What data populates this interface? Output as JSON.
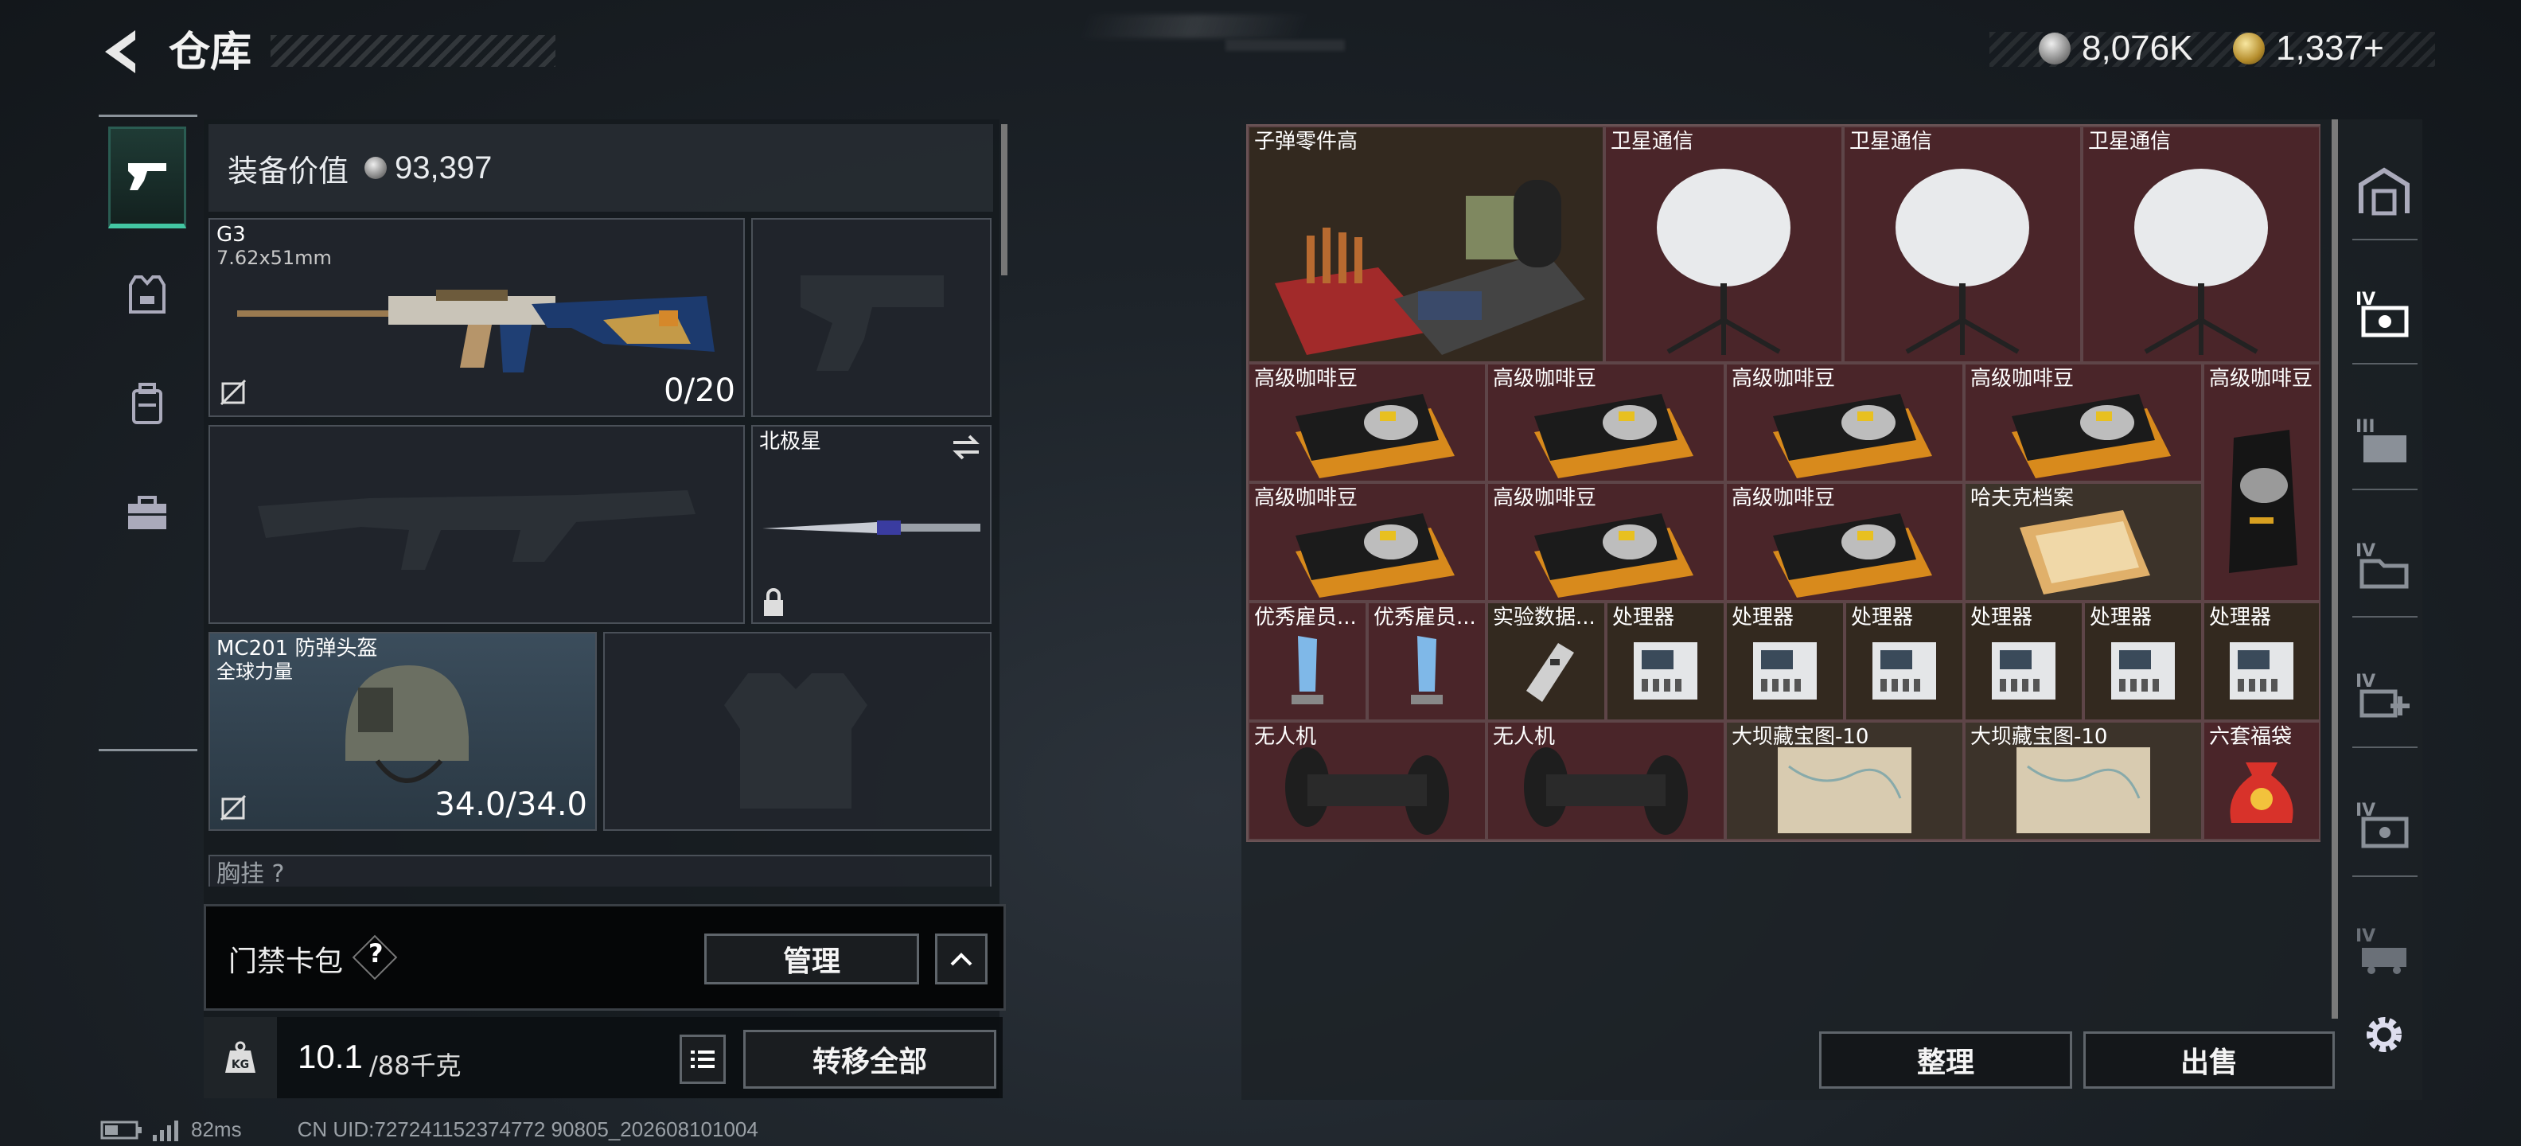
{
  "header": {
    "title": "仓库",
    "currency_silver": "8,076K",
    "currency_gold": "1,337+"
  },
  "rail": {
    "items": [
      "weapon-pistol-icon",
      "armor-vest-icon",
      "backpack-icon",
      "briefcase-icon"
    ]
  },
  "loadout": {
    "value_label": "装备价值",
    "value": "93,397",
    "primary": {
      "name": "G3",
      "caliber": "7.62x51mm",
      "ammo": "0/20"
    },
    "melee": {
      "name": "北极星"
    },
    "helmet": {
      "name": "MC201 防弹头盔",
      "sub": "全球力量",
      "durability": "34.0/34.0"
    },
    "chest_partial": "胸挂 ?"
  },
  "keycard": {
    "label": "门禁卡包",
    "help": "?",
    "manage_label": "管理"
  },
  "capacity": {
    "current": "10.1",
    "max": "/88千克",
    "transfer_label": "转移全部"
  },
  "stash": {
    "cells": [
      {
        "name": "子弹零件高"
      },
      {
        "name": "卫星通信"
      },
      {
        "name": "卫星通信"
      },
      {
        "name": "卫星通信"
      },
      {
        "name": "高级咖啡豆"
      },
      {
        "name": "高级咖啡豆"
      },
      {
        "name": "高级咖啡豆"
      },
      {
        "name": "高级咖啡豆"
      },
      {
        "name": "高级咖啡豆"
      },
      {
        "name": "高级咖啡豆"
      },
      {
        "name": "高级咖啡豆"
      },
      {
        "name": "高级咖啡豆"
      },
      {
        "name": "哈夫克档案"
      },
      {
        "name": "优秀雇员..."
      },
      {
        "name": "优秀雇员..."
      },
      {
        "name": "实验数据..."
      },
      {
        "name": "处理器"
      },
      {
        "name": "处理器"
      },
      {
        "name": "处理器"
      },
      {
        "name": "处理器"
      },
      {
        "name": "处理器"
      },
      {
        "name": "处理器"
      },
      {
        "name": "无人机"
      },
      {
        "name": "无人机"
      },
      {
        "name": "大坝藏宝图-10"
      },
      {
        "name": "大坝藏宝图-10"
      },
      {
        "name": "六套福袋"
      }
    ],
    "sort_label": "整理",
    "sell_label": "出售"
  },
  "footer": {
    "ping": "82ms",
    "uid": "CN UID:727241152374772 90805_202608101004"
  }
}
